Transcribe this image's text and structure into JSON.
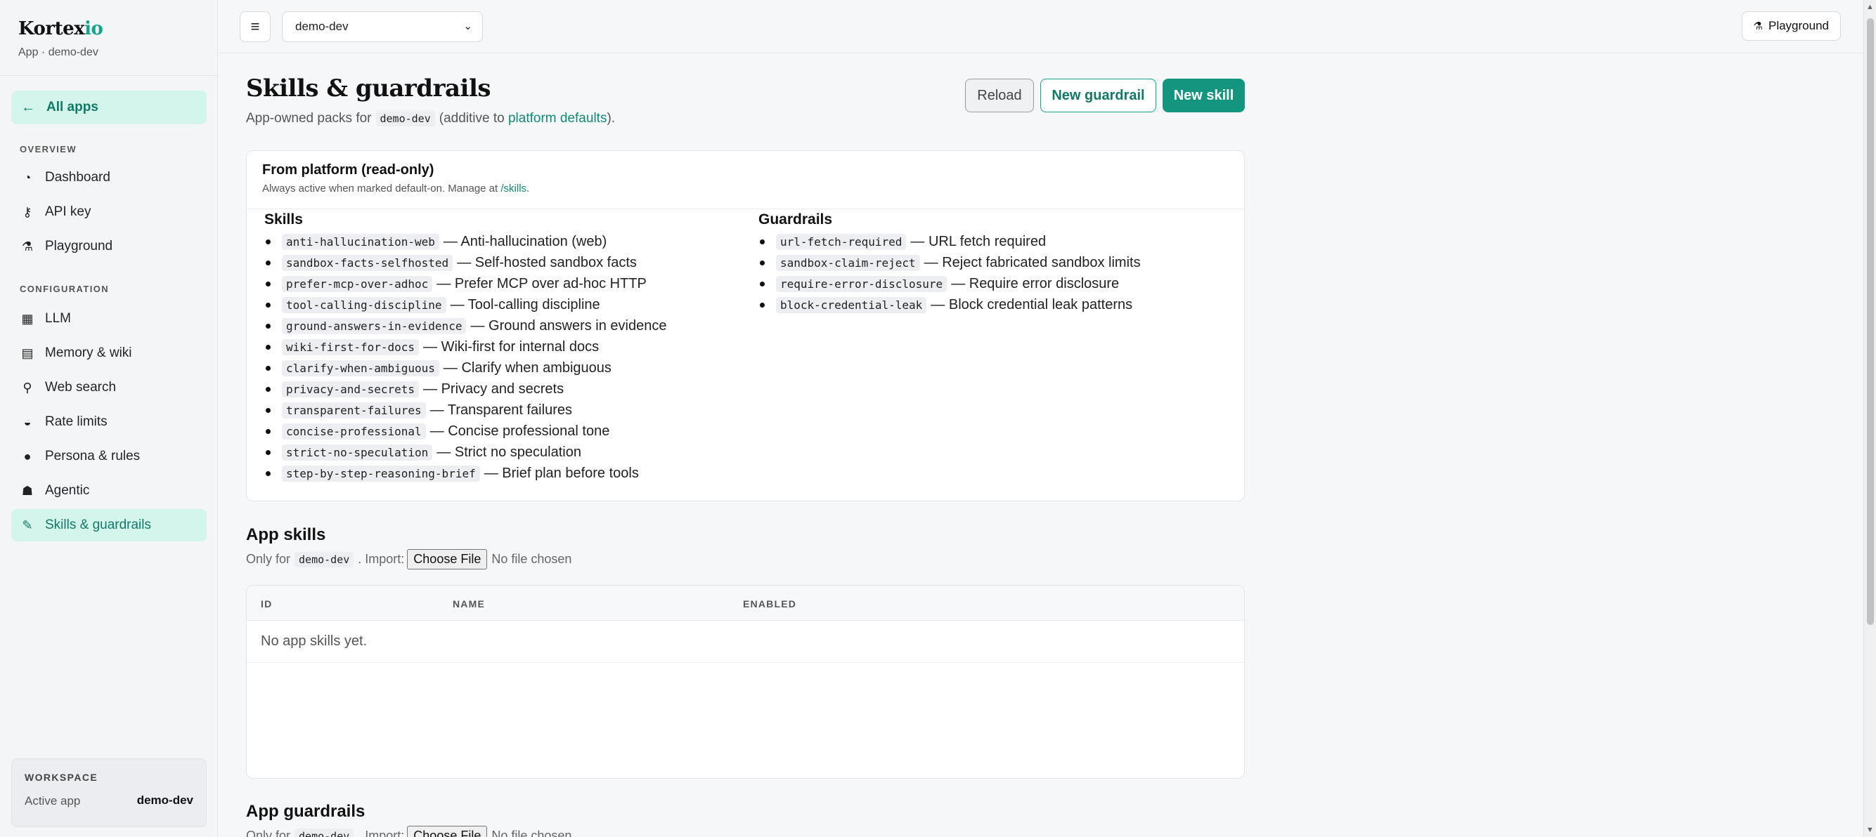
{
  "sidebar": {
    "brand_main": "Kortex",
    "brand_accent": "io",
    "brand_sub": "App · demo-dev",
    "all_apps": "All apps",
    "overview_label": "OVERVIEW",
    "overview_items": [
      "Dashboard",
      "API key",
      "Playground"
    ],
    "config_label": "CONFIGURATION",
    "config_items": [
      "LLM",
      "Memory & wiki",
      "Web search",
      "Rate limits",
      "Persona & rules",
      "Agentic",
      "Skills & guardrails"
    ],
    "workspace": {
      "label": "WORKSPACE",
      "key": "Active app",
      "value": "demo-dev"
    }
  },
  "topbar": {
    "app_select_value": "demo-dev",
    "playground": "Playground"
  },
  "header": {
    "title": "Skills & guardrails",
    "sub_prefix": "App-owned packs for",
    "sub_app": "demo-dev",
    "sub_mid": "(additive to",
    "sub_link": "platform defaults",
    "sub_suffix": ").",
    "reload": "Reload",
    "new_guardrail": "New guardrail",
    "new_skill": "New skill"
  },
  "platform": {
    "title": "From platform (read-only)",
    "note_prefix": "Always active when marked default-on. Manage at",
    "note_link": "/skills",
    "note_suffix": ".",
    "skills_title": "Skills",
    "skills": [
      {
        "id": "anti-hallucination-web",
        "name": "— Anti-hallucination (web)"
      },
      {
        "id": "sandbox-facts-selfhosted",
        "name": "— Self-hosted sandbox facts"
      },
      {
        "id": "prefer-mcp-over-adhoc",
        "name": "— Prefer MCP over ad-hoc HTTP"
      },
      {
        "id": "tool-calling-discipline",
        "name": "— Tool-calling discipline"
      },
      {
        "id": "ground-answers-in-evidence",
        "name": "— Ground answers in evidence"
      },
      {
        "id": "wiki-first-for-docs",
        "name": "— Wiki-first for internal docs"
      },
      {
        "id": "clarify-when-ambiguous",
        "name": "— Clarify when ambiguous"
      },
      {
        "id": "privacy-and-secrets",
        "name": "— Privacy and secrets"
      },
      {
        "id": "transparent-failures",
        "name": "— Transparent failures"
      },
      {
        "id": "concise-professional",
        "name": "— Concise professional tone"
      },
      {
        "id": "strict-no-speculation",
        "name": "— Strict no speculation"
      },
      {
        "id": "step-by-step-reasoning-brief",
        "name": "— Brief plan before tools"
      }
    ],
    "guardrails_title": "Guardrails",
    "guardrails": [
      {
        "id": "url-fetch-required",
        "name": "— URL fetch required"
      },
      {
        "id": "sandbox-claim-reject",
        "name": "— Reject fabricated sandbox limits"
      },
      {
        "id": "require-error-disclosure",
        "name": "— Require error disclosure"
      },
      {
        "id": "block-credential-leak",
        "name": "— Block credential leak patterns"
      }
    ]
  },
  "app_skills": {
    "title": "App skills",
    "sub_prefix": "Only for",
    "sub_app": "demo-dev",
    "sub_import": ". Import:",
    "choose_file": "Choose File",
    "no_file": "No file chosen",
    "columns": [
      "ID",
      "NAME",
      "ENABLED"
    ],
    "empty": "No app skills yet."
  },
  "app_guardrails": {
    "title": "App guardrails",
    "sub_prefix": "Only for",
    "sub_app": "demo-dev",
    "sub_import": ". Import:",
    "choose_file": "Choose File",
    "no_file": "No file chosen"
  }
}
